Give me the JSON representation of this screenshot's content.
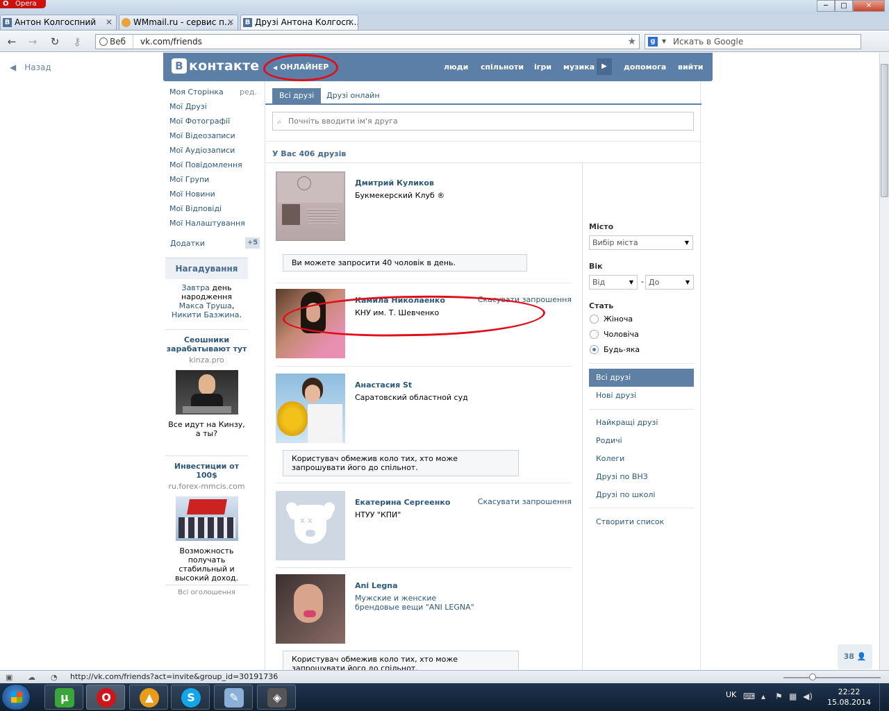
{
  "window": {
    "app_name": "Opera",
    "controls": {
      "minimize": "─",
      "maximize": "□",
      "close": "✕"
    }
  },
  "tabs": [
    {
      "favicon": "В",
      "title": "Антон Колгоспний"
    },
    {
      "favicon": "",
      "title": "WMmail.ru - сервис п..."
    },
    {
      "favicon": "В",
      "title": "Друзі Антона Колгосп..."
    }
  ],
  "newtab_label": "+",
  "toolbar": {
    "web_label": "Веб",
    "url": "vk.com/friends",
    "search_placeholder": "Искать в Google",
    "search_engine": "g"
  },
  "page": {
    "back_label": "Назад",
    "header": {
      "logo_letter": "В",
      "logo_text": "контакте",
      "onliner": "ОНЛАЙНЕР",
      "links": [
        "люди",
        "спільноти",
        "ігри",
        "музика",
        "допомога",
        "вийти"
      ]
    },
    "sidebar": {
      "edit_label": "ред.",
      "items": [
        "Моя Сторінка",
        "Мої Друзі",
        "Мої Фотографії",
        "Мої Відеозаписи",
        "Мої Аудіозаписи",
        "Мої Повідомлення",
        "Мої Групи",
        "Мої Новини",
        "Мої Відповіді",
        "Мої Налаштування"
      ],
      "apps_label": "Додатки",
      "apps_count": "+5",
      "reminder": {
        "title": "Нагадування",
        "pre": "Завтра",
        "mid": " день народження ",
        "name1": "Макса Труша",
        "sep": ", ",
        "name2": "Никити Базжина",
        "end": "."
      },
      "ads": [
        {
          "title": "Сеошники зарабатывают тут",
          "site": "kinza.pro",
          "desc": "Все идут на Кинзу, а ты?"
        },
        {
          "title": "Инвестиции от 100$",
          "site": "ru.forex-mmcis.com",
          "desc": "Возможность получать стабильный и высокий доход."
        }
      ],
      "all_ads": "Всі оголошення"
    },
    "main": {
      "tab_all": "Всі друзі",
      "tab_online": "Друзі онлайн",
      "search_placeholder": "Почніть вводити ім'я друга",
      "count_text": "У Вас 406 друзів",
      "cancel_label": "Скасувати запрошення",
      "friends": [
        {
          "name": "Дмитрий Куликов",
          "sub": "Букмекерский Клуб ®",
          "message": "Ви можете запросити 40 чоловік в день."
        },
        {
          "name": "Камила Николаенко",
          "sub": "КНУ им. Т. Шевченко"
        },
        {
          "name": "Анастасия St",
          "sub": "Саратовский областной суд",
          "message": "Користувач обмежив коло тих, хто може запрошувати його до спільнот."
        },
        {
          "name": "Екатерина Сергеенко",
          "sub": "НТУУ \"КПИ\""
        },
        {
          "name": "Ani Legna",
          "sub": "Мужские и женские брендовые вещи \"ANI LEGNA\"",
          "message": "Користувач обмежив коло тих, хто може запрошувати його до спільнот."
        }
      ]
    },
    "filters": {
      "city_label": "Місто",
      "city_value": "Вибір міста",
      "age_label": "Вік",
      "age_from": "Від",
      "age_dash": "-",
      "age_to": "До",
      "sex_label": "Стать",
      "sex_options": [
        "Жіноча",
        "Чоловіча",
        "Будь-яка"
      ],
      "sex_selected": "Будь-яка",
      "lists": [
        "Всі друзі",
        "Нові друзі",
        "Найкращі друзі",
        "Родичі",
        "Колеги",
        "Друзі по ВНЗ",
        "Друзі по школі",
        "Створити список"
      ]
    },
    "counter": "38"
  },
  "status_url": "http://vk.com/friends?act=invite&group_id=30191736",
  "taskbar": {
    "lang": "UK",
    "time": "22:22",
    "date": "15.08.2014"
  },
  "colors": {
    "vk_blue": "#5b7fa6",
    "link": "#2b587a",
    "annotation_red": "#e0101a"
  }
}
